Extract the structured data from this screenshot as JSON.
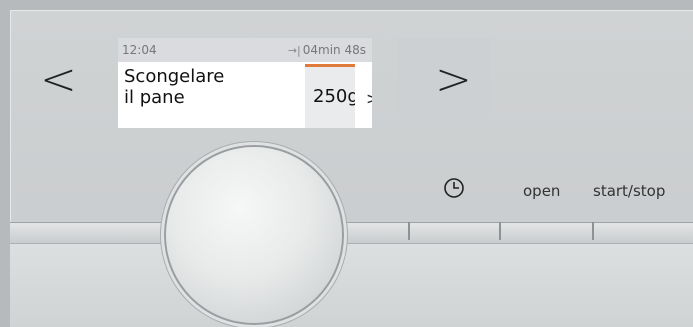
{
  "navigation": {
    "left_arrow": "<",
    "right_arrow": ">"
  },
  "display": {
    "time": "12:04",
    "timer_icon": "→|",
    "remaining": "04min 48s",
    "program_line1": "Scongelare",
    "program_line2": "il pane",
    "weight": "250g",
    "next_chevron": ">"
  },
  "buttons": {
    "clock_icon": "clock-icon",
    "open_label": "open",
    "start_stop_label": "start/stop"
  },
  "colors": {
    "accent": "#e07a3a",
    "panel": "#cfd2d3",
    "display_bg": "#ffffff"
  }
}
